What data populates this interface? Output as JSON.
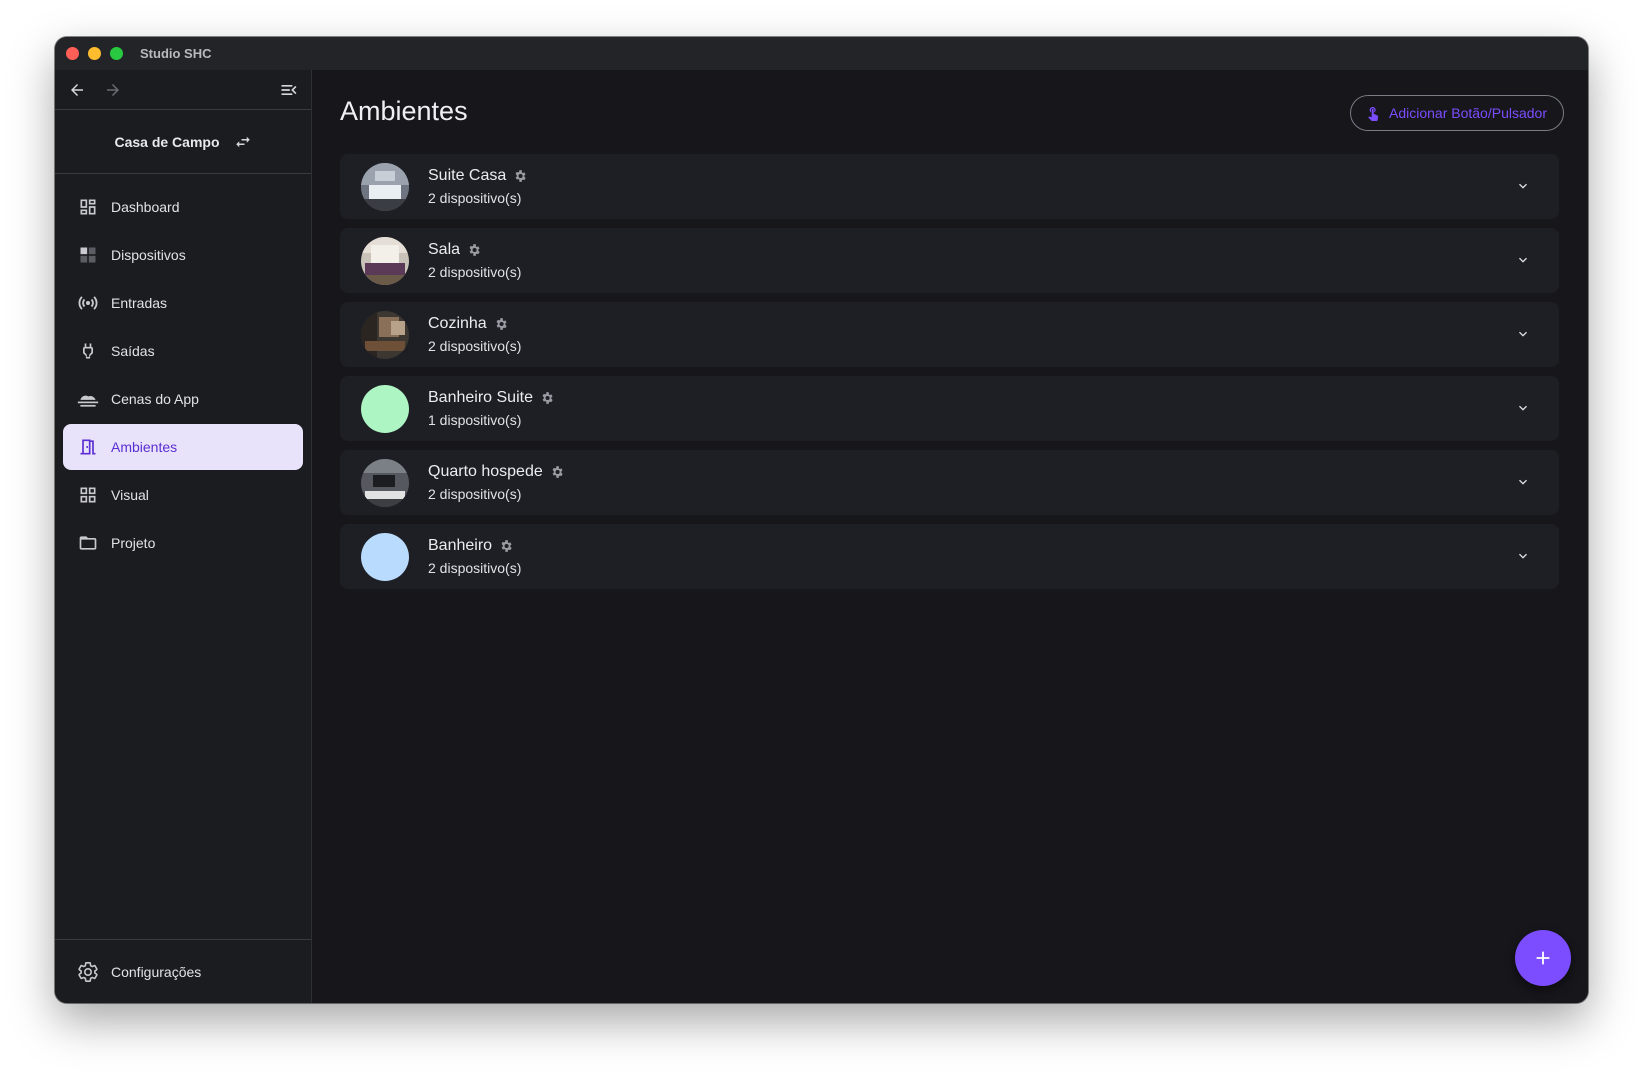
{
  "window": {
    "title": "Studio SHC"
  },
  "sidebar": {
    "project_name": "Casa de Campo",
    "items": [
      {
        "label": "Dashboard",
        "icon": "dashboard-icon"
      },
      {
        "label": "Dispositivos",
        "icon": "devices-icon"
      },
      {
        "label": "Entradas",
        "icon": "sensors-icon"
      },
      {
        "label": "Saídas",
        "icon": "plug-icon"
      },
      {
        "label": "Cenas do App",
        "icon": "cloud-icon"
      },
      {
        "label": "Ambientes",
        "icon": "door-icon",
        "active": true
      },
      {
        "label": "Visual",
        "icon": "grid-icon"
      },
      {
        "label": "Projeto",
        "icon": "folder-icon"
      }
    ],
    "settings_label": "Configurações"
  },
  "main": {
    "title": "Ambientes",
    "add_button_label": "Adicionar Botão/Pulsador",
    "rooms": [
      {
        "name": "Suite Casa",
        "count": "2 dispositivo(s)",
        "avatar": "photo-bedroom"
      },
      {
        "name": "Sala",
        "count": "2 dispositivo(s)",
        "avatar": "photo-living-room"
      },
      {
        "name": "Cozinha",
        "count": "2 dispositivo(s)",
        "avatar": "photo-kitchen"
      },
      {
        "name": "Banheiro Suite",
        "count": "1 dispositivo(s)",
        "avatar": "color",
        "color": "#aef5c4"
      },
      {
        "name": "Quarto hospede",
        "count": "2 dispositivo(s)",
        "avatar": "photo-guest-room"
      },
      {
        "name": "Banheiro",
        "count": "2 dispositivo(s)",
        "avatar": "color",
        "color": "#b9dbfe"
      }
    ]
  },
  "colors": {
    "accent": "#7c4dff",
    "active_bg": "#e8e2fb",
    "background": "#16161b",
    "card": "#1e1f24"
  }
}
